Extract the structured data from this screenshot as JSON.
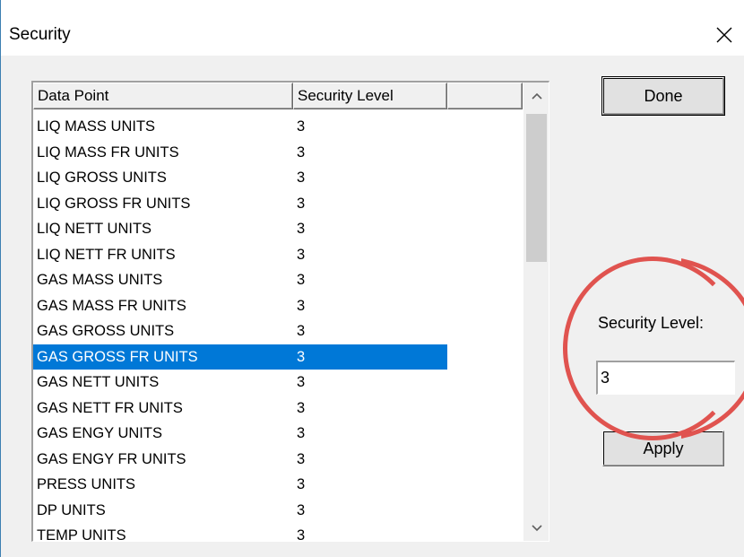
{
  "window": {
    "title": "Security"
  },
  "list": {
    "columns": [
      "Data Point",
      "Security Level",
      ""
    ],
    "rows": [
      {
        "name": "LIQ MASS UNITS",
        "level": "3"
      },
      {
        "name": "LIQ MASS FR UNITS",
        "level": "3"
      },
      {
        "name": "LIQ GROSS UNITS",
        "level": "3"
      },
      {
        "name": "LIQ GROSS FR UNITS",
        "level": "3"
      },
      {
        "name": "LIQ NETT UNITS",
        "level": "3"
      },
      {
        "name": "LIQ NETT FR UNITS",
        "level": "3"
      },
      {
        "name": "GAS MASS UNITS",
        "level": "3"
      },
      {
        "name": "GAS MASS FR UNITS",
        "level": "3"
      },
      {
        "name": "GAS GROSS UNITS",
        "level": "3"
      },
      {
        "name": "GAS GROSS FR UNITS",
        "level": "3"
      },
      {
        "name": "GAS NETT UNITS",
        "level": "3"
      },
      {
        "name": "GAS NETT FR UNITS",
        "level": "3"
      },
      {
        "name": "GAS ENGY UNITS",
        "level": "3"
      },
      {
        "name": "GAS ENGY FR UNITS",
        "level": "3"
      },
      {
        "name": "PRESS UNITS",
        "level": "3"
      },
      {
        "name": "DP UNITS",
        "level": "3"
      },
      {
        "name": "TEMP UNITS",
        "level": "3"
      }
    ],
    "selected_index": 9
  },
  "buttons": {
    "done": "Done",
    "apply": "Apply"
  },
  "security": {
    "label": "Security Level:",
    "value": "3"
  },
  "icons": {
    "close": "close-icon",
    "scroll_up": "scroll-up-arrow-icon",
    "scroll_down": "scroll-down-arrow-icon"
  },
  "colors": {
    "selection": "#0078d7",
    "annotation": "#e0534f"
  }
}
